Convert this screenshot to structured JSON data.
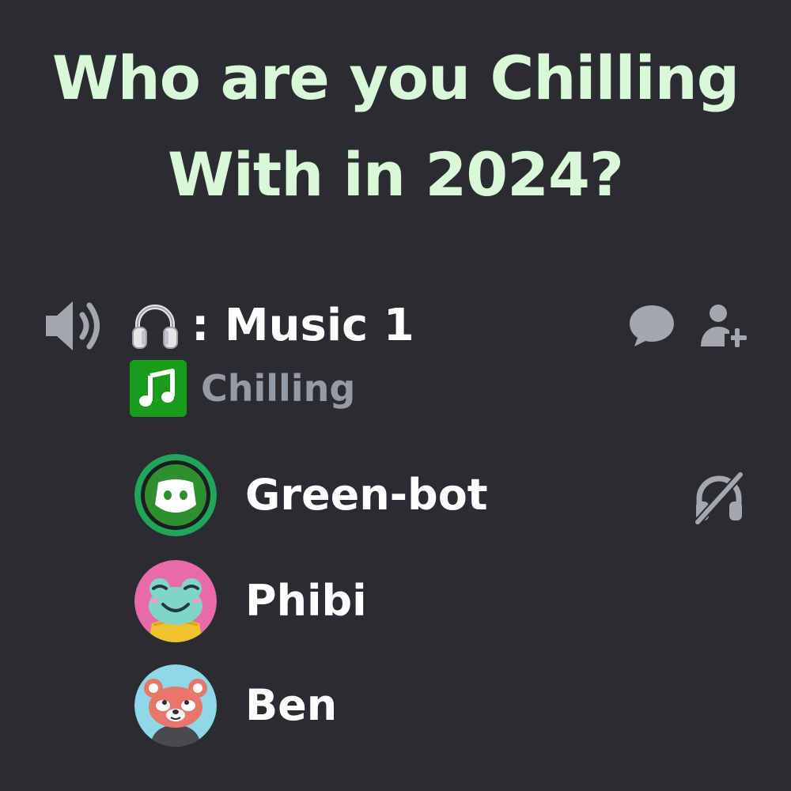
{
  "headline": {
    "line1": "Who are you Chilling",
    "line2": "With in 2024?"
  },
  "channel": {
    "speaker_icon": "speaker-icon",
    "emoji_icon": "headphone-icon",
    "name": ": Music 1",
    "actions": [
      "chat-bubble-icon",
      "add-user-icon"
    ]
  },
  "status": {
    "icon": "music-note-icon",
    "text": "Chilling"
  },
  "members": [
    {
      "name": "Green-bot",
      "avatar": "discord-bot-avatar",
      "state_icon": "deafened-icon"
    },
    {
      "name": "Phibi",
      "avatar": "frog-avatar"
    },
    {
      "name": "Ben",
      "avatar": "red-panda-avatar"
    }
  ],
  "colors": {
    "background": "#2b2c32",
    "headline": "#d8f8d8",
    "icon_gray": "#a3a7ae",
    "status_text": "#949ba4",
    "speaking_ring": "#23a559",
    "music_green": "#1a9b1a"
  }
}
